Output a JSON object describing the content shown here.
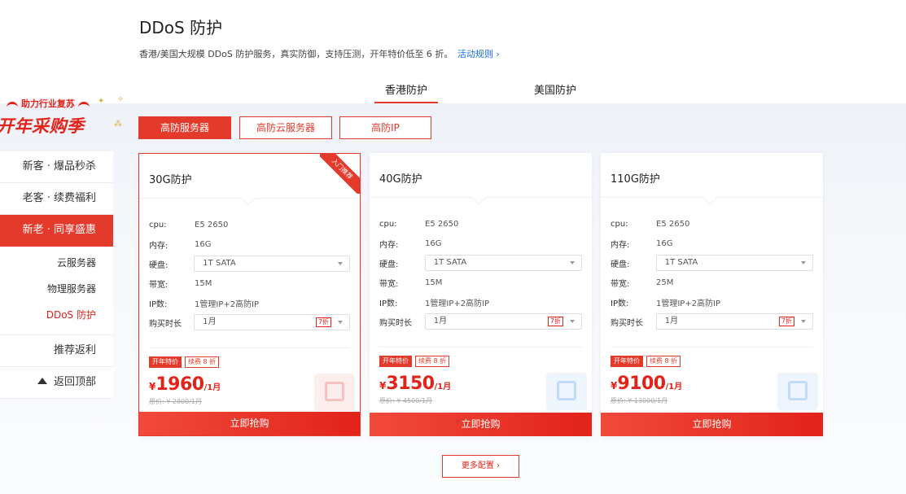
{
  "header": {
    "title": "DDoS 防护",
    "subtitle": "香港/美国大规模 DDoS 防护服务，真实防御，支持压测，开年特价低至 6 折。",
    "rule_link": "活动规则 ›"
  },
  "region_tabs": [
    "香港防护",
    "美国防护"
  ],
  "promo": {
    "top": "助力行业复苏",
    "big": "开年采购季"
  },
  "sidebar": {
    "items": [
      "新客 · 爆品秒杀",
      "老客 · 续费福利",
      "新老 · 同享盛惠"
    ],
    "subitems": [
      "云服务器",
      "物理服务器",
      "DDoS 防护"
    ],
    "bottom": [
      "推荐返利",
      "返回顶部"
    ]
  },
  "product_tabs": [
    "高防服务器",
    "高防云服务器",
    "高防IP"
  ],
  "labels": {
    "cpu": "cpu:",
    "memory": "内存:",
    "disk": "硬盘:",
    "bandwidth": "带宽:",
    "ip": "IP数:",
    "duration": "购买时长",
    "badge_sale": "开年特价",
    "badge_renew": "续费 8 折",
    "buy": "立即抢购",
    "currency": "¥",
    "per": "/1月",
    "ribbon": "入门推荐"
  },
  "cards": [
    {
      "title": "30G防护",
      "cpu": "E5 2650",
      "memory": "16G",
      "disk": "1T SATA",
      "bandwidth": "15M",
      "ip": "1管理IP+2高防IP",
      "duration": "1月",
      "discount": "7折",
      "price": "1960",
      "orig": "原价: ¥ 2800/1月"
    },
    {
      "title": "40G防护",
      "cpu": "E5 2650",
      "memory": "16G",
      "disk": "1T SATA",
      "bandwidth": "15M",
      "ip": "1管理IP+2高防IP",
      "duration": "1月",
      "discount": "7折",
      "price": "3150",
      "orig": "原价: ¥ 4500/1月"
    },
    {
      "title": "110G防护",
      "cpu": "E5 2650",
      "memory": "16G",
      "disk": "1T SATA",
      "bandwidth": "25M",
      "ip": "1管理IP+2高防IP",
      "duration": "1月",
      "discount": "7折",
      "price": "9100",
      "orig": "原价: ¥ 13000/1月"
    }
  ],
  "more": "更多配置 ›",
  "colors": {
    "accent": "#e33a2b",
    "link": "#1a73e8"
  }
}
